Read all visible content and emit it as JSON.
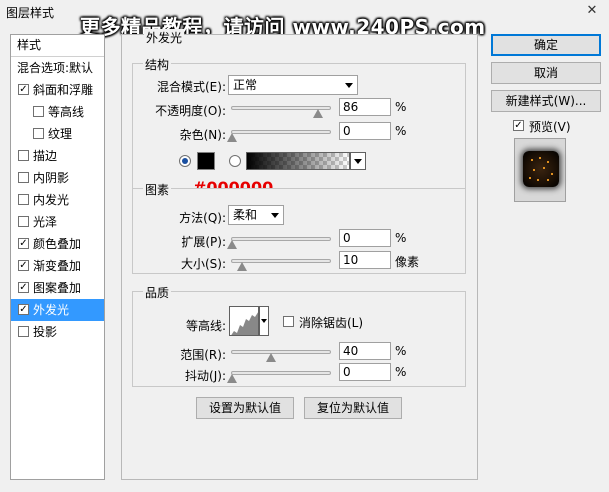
{
  "window": {
    "title": "图层样式",
    "close_glyph": "✕"
  },
  "watermark": "更多精品教程，请访问 www.240PS.com",
  "style_list": {
    "header": "样式",
    "blend_defaults": "混合选项:默认",
    "items": [
      {
        "label": "斜面和浮雕",
        "checked": true,
        "sub": false,
        "selected": false
      },
      {
        "label": "等高线",
        "checked": false,
        "sub": true,
        "selected": false
      },
      {
        "label": "纹理",
        "checked": false,
        "sub": true,
        "selected": false
      },
      {
        "label": "描边",
        "checked": false,
        "sub": false,
        "selected": false
      },
      {
        "label": "内阴影",
        "checked": false,
        "sub": false,
        "selected": false
      },
      {
        "label": "内发光",
        "checked": false,
        "sub": false,
        "selected": false
      },
      {
        "label": "光泽",
        "checked": false,
        "sub": false,
        "selected": false
      },
      {
        "label": "颜色叠加",
        "checked": true,
        "sub": false,
        "selected": false
      },
      {
        "label": "渐变叠加",
        "checked": true,
        "sub": false,
        "selected": false
      },
      {
        "label": "图案叠加",
        "checked": true,
        "sub": false,
        "selected": false
      },
      {
        "label": "外发光",
        "checked": true,
        "sub": false,
        "selected": true
      },
      {
        "label": "投影",
        "checked": false,
        "sub": false,
        "selected": false
      }
    ]
  },
  "outer_glow": {
    "partial_title": "外发光",
    "structure": {
      "legend": "结构",
      "blend_mode_label": "混合模式(E):",
      "blend_mode_value": "正常",
      "opacity_label": "不透明度(O):",
      "opacity_value": "86",
      "opacity_unit": "%",
      "noise_label": "杂色(N):",
      "noise_value": "0",
      "noise_unit": "%",
      "color_hex_label": "#000000",
      "glow_color": "#000000"
    },
    "elements": {
      "legend": "图素",
      "technique_label": "方法(Q):",
      "technique_value": "柔和",
      "spread_label": "扩展(P):",
      "spread_value": "0",
      "spread_unit": "%",
      "size_label": "大小(S):",
      "size_value": "10",
      "size_unit": "像素"
    },
    "quality": {
      "legend": "品质",
      "contour_label": "等高线:",
      "antialias_label": "消除锯齿(L)",
      "antialias_checked": false,
      "range_label": "范围(R):",
      "range_value": "40",
      "range_unit": "%",
      "jitter_label": "抖动(J):",
      "jitter_value": "0",
      "jitter_unit": "%"
    },
    "set_default": "设置为默认值",
    "reset_default": "复位为默认值"
  },
  "buttons": {
    "ok": "确定",
    "cancel": "取消",
    "new_style": "新建样式(W)...",
    "preview_label": "预览(V)",
    "preview_checked": true
  },
  "colors": {
    "selection": "#3399ff",
    "red_annotation": "#e60000"
  }
}
